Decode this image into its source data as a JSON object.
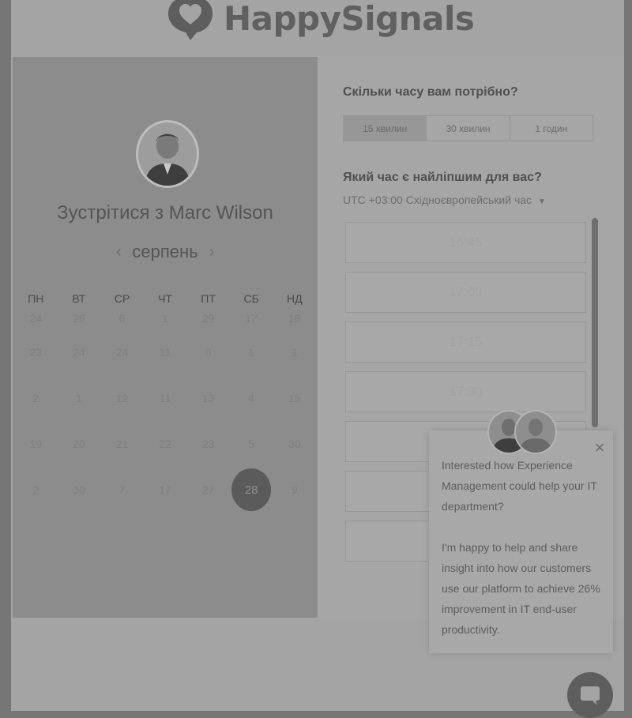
{
  "brand": {
    "name": "HappySignals"
  },
  "left_panel": {
    "title": "Зустрітися з Marc Wilson",
    "month": "серпень",
    "weekdays": [
      "ПН",
      "ВТ",
      "СР",
      "ЧТ",
      "ПТ",
      "СБ",
      "НД"
    ],
    "weeks": [
      [
        "24",
        "25",
        "6",
        "1",
        "29",
        "17",
        "18"
      ],
      [
        "23",
        "24",
        "24",
        "11",
        "8",
        "1",
        "1"
      ],
      [
        "2",
        "1",
        "12",
        "11",
        "13",
        "4",
        "15"
      ],
      [
        "19",
        "20",
        "21",
        "22",
        "23",
        "5",
        "30"
      ],
      [
        "2",
        "30",
        "7",
        "17",
        "27",
        "28",
        "9"
      ]
    ],
    "selected_day": "28"
  },
  "right_panel": {
    "duration_question": "Скільки часу вам потрібно?",
    "durations": [
      "15 хвилин",
      "30 хвилин",
      "1 годин"
    ],
    "active_duration": "15 хвилин",
    "time_question": "Який час є найліпшим для вас?",
    "timezone": "UTC +03:00 Східноєвропейський час",
    "slots": [
      "16:45",
      "17:00",
      "17:15",
      "17:30",
      "",
      "",
      ""
    ]
  },
  "chat_popup": {
    "paragraph_1": "Interested how Experience Management could help your IT department?",
    "paragraph_2": "I'm happy to help and share insight into how our customers use our platform to achieve 26% improvement in IT end-user productivity."
  },
  "icons": {
    "logo": "happysignals-logo-icon",
    "prev": "chevron-left-icon",
    "next": "chevron-right-icon",
    "close": "close-icon",
    "chat": "chat-bubble-icon",
    "dropdown": "caret-down-icon"
  },
  "colors": {
    "overlay_dim": "#767676",
    "selected_day": "#5b5b5b"
  }
}
